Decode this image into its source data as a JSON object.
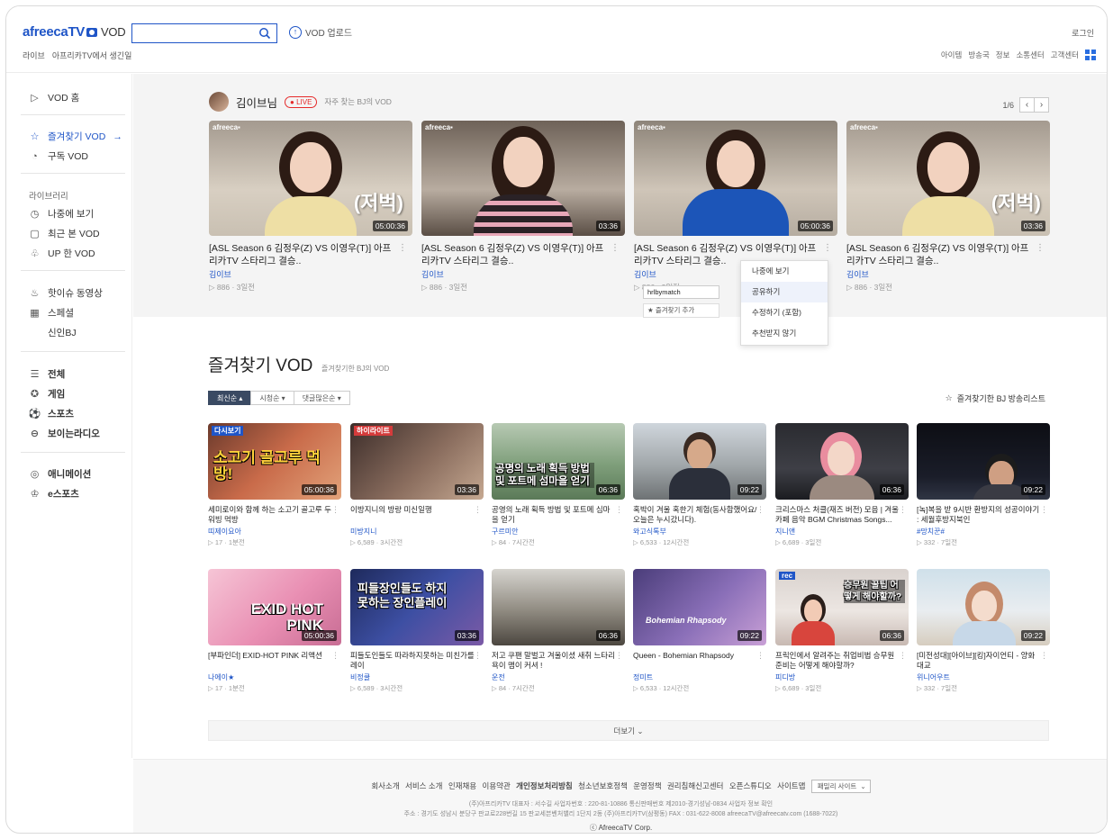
{
  "header": {
    "logo": "afreecaTV",
    "logo_suffix": "VOD",
    "search_placeholder": "",
    "upload_label": "VOD 업로드",
    "login_label": "로그인",
    "subnav": [
      "라이브",
      "아프리카TV에서 생긴일"
    ],
    "top_right": [
      "아이템",
      "방송국",
      "정보",
      "소통센터",
      "고객센터"
    ]
  },
  "sidebar": {
    "vod_home": "VOD 홈",
    "favorites_vod": "즐겨찾기 VOD",
    "subscribe_vod": "구독 VOD",
    "library_label": "라이브러리",
    "watch_later": "나중에 보기",
    "recent": "최근 본 VOD",
    "up_vod": "UP 한 VOD",
    "hot_issue": "핫이슈 동영상",
    "special": "스페셜",
    "new_bj": "신인BJ",
    "all": "전체",
    "game": "게임",
    "sports": "스포츠",
    "boradio": "보이는라디오",
    "animation": "애니메이션",
    "esports": "e스포츠"
  },
  "favorite_bj": {
    "name": "김이브님",
    "live": "LIVE",
    "sub": "자주 찾는 BJ의 VOD",
    "pager": "1/6",
    "cards": [
      {
        "title": "[ASL Season 6 김정우(Z) VS 이영우(T)] 아프리카TV 스타리그 결승..",
        "bj": "김이브",
        "meta": "▷ 886 · 3일전",
        "duration": "05:00:36",
        "tag": "(저벅)"
      },
      {
        "title": "[ASL Season 6 김정우(Z) VS 이영우(T)] 아프리카TV 스타리그 결승..",
        "bj": "김이브",
        "meta": "▷ 886 · 3일전",
        "duration": "03:36",
        "tag": ""
      },
      {
        "title": "[ASL Season 6 김정우(Z) VS 이영우(T)] 아프리카TV 스타리그 결승..",
        "bj": "김이브",
        "meta": "▷ 886 · 3일전",
        "duration": "05:00:36",
        "tag": ""
      },
      {
        "title": "[ASL Season 6 김정우(Z) VS 이영우(T)] 아프리카TV 스타리그 결승..",
        "bj": "김이브",
        "meta": "▷ 886 · 3일전",
        "duration": "03:36",
        "tag": "(저벅)"
      }
    ],
    "context_menu": [
      "나중에 보기",
      "공유하기",
      "수정하기 (포함)",
      "추천받지 않기"
    ],
    "tag_input": "hrlbymatch",
    "tag_tip": "즐겨찾기 추가"
  },
  "favorites_section": {
    "title": "즐겨찾기 VOD",
    "sub": "즐겨찾기한 BJ의 VOD",
    "sorts": [
      "최신순",
      "시청순",
      "댓글많은순"
    ],
    "bj_list_link": "즐겨찾기한 BJ 방송리스트",
    "more": "더보기",
    "videos": [
      {
        "title": "세미로이와 함께 하는 소고기 골고루 두 워빙 먹방",
        "bj": "띠제이요아",
        "meta": "▷ 17 · 1분전",
        "duration": "05:00:36",
        "overlay": "소고기 골고루 먹방!",
        "corner": "다시보기"
      },
      {
        "title": "이방지니의 방랑 미신일행",
        "bj": "미방지니",
        "meta": "▷ 6,589 · 3시간전",
        "duration": "03:36",
        "overlay": "",
        "corner": "하이라이트"
      },
      {
        "title": "공영의 노래 획득 방법 및 포트메 심마을 얻기",
        "bj": "구르미안",
        "meta": "▷ 84 · 7시간전",
        "duration": "06:36",
        "overlay": "공명의 노래 획득 방법 및 포트메 섬마을 얻기",
        "corner": ""
      },
      {
        "title": "혹박이 겨울 혹한기 체험(동사함했어요/오늘은 누시갔니다).",
        "bj": "와고식톡부",
        "meta": "▷ 6,533 · 12시간전",
        "duration": "09:22",
        "overlay": "",
        "corner": ""
      },
      {
        "title": "크리스마스 처클(재즈 버전) 모음 | 겨울 카페 음악 BGM Christmas Songs...",
        "bj": "지니앤",
        "meta": "▷ 6,689 · 3일전",
        "duration": "06:36",
        "overlay": "",
        "corner": ""
      },
      {
        "title": "[녹]복을 받 9시반 환방지의 성공이야기 : 세월후방지북인",
        "bj": "#망치꾼#",
        "meta": "▷ 332 · 7일전",
        "duration": "09:22",
        "overlay": "",
        "corner": ""
      },
      {
        "title": "[부파인더] EXID-HOT PINK 리액션",
        "bj": "나에이★",
        "meta": "▷ 17 · 1분전",
        "duration": "05:00:36",
        "overlay": "EXID HOT PINK",
        "corner": ""
      },
      {
        "title": "피들도인들도 따라하지못하는 미친가를 레이",
        "bj": "비정쿨",
        "meta": "▷ 6,589 · 3시간전",
        "duration": "03:36",
        "overlay": "피들장인들도 하지못하는 장인플레이",
        "corner": ""
      },
      {
        "title": "저고 쿠팬 말벌고 겨울이셨 새취 느타리 욕이 맴이 커셔 !",
        "bj": "운전",
        "meta": "▷ 84 · 7시간전",
        "duration": "06:36",
        "overlay": "",
        "corner": ""
      },
      {
        "title": "Queen - Bohemian Rhapsody",
        "bj": "정미트",
        "meta": "▷ 6,533 · 12시간전",
        "duration": "09:22",
        "overlay": "Bohemian Rhapsody",
        "corner": ""
      },
      {
        "title": "프릭인에서 알려주는 취업비법 승무원 준비는 어떻게 해야할까?",
        "bj": "피디방",
        "meta": "▷ 6,689 · 3일전",
        "duration": "06:36",
        "overlay": "승무원 꿀팁 어떻게 해야할까?",
        "corner": "rec"
      },
      {
        "title": "[미전성대][아이브][킹]자이언티 - 양화 대교",
        "bj": "위니어우트",
        "meta": "▷ 332 · 7일전",
        "duration": "09:22",
        "overlay": "",
        "corner": ""
      }
    ]
  },
  "footer": {
    "links": [
      "회사소개",
      "서비스 소개",
      "인재채용",
      "이용약관",
      "개인정보처리방침",
      "청소년보호정책",
      "운영정책",
      "권리침해신고센터",
      "오픈스튜디오",
      "사이트맵"
    ],
    "family_site": "패밀리 사이트",
    "info1": "(주)아프리카TV   대표자 : 서수길   사업자번호 : 220-81-10886   통신판매번호 제2010-경기성남-0834   사업자 정보 확인",
    "info2": "주소 : 경기도 성남시 분당구 판교로228번길 15 판교세븐벤처밸리 1단지 2동 (주)아프리카TV(삼평동)   FAX : 031-622-8008   afreecaTV@afreecatv.com (1688-7022)",
    "copyright": "ⓒ AfreecaTV Corp."
  }
}
